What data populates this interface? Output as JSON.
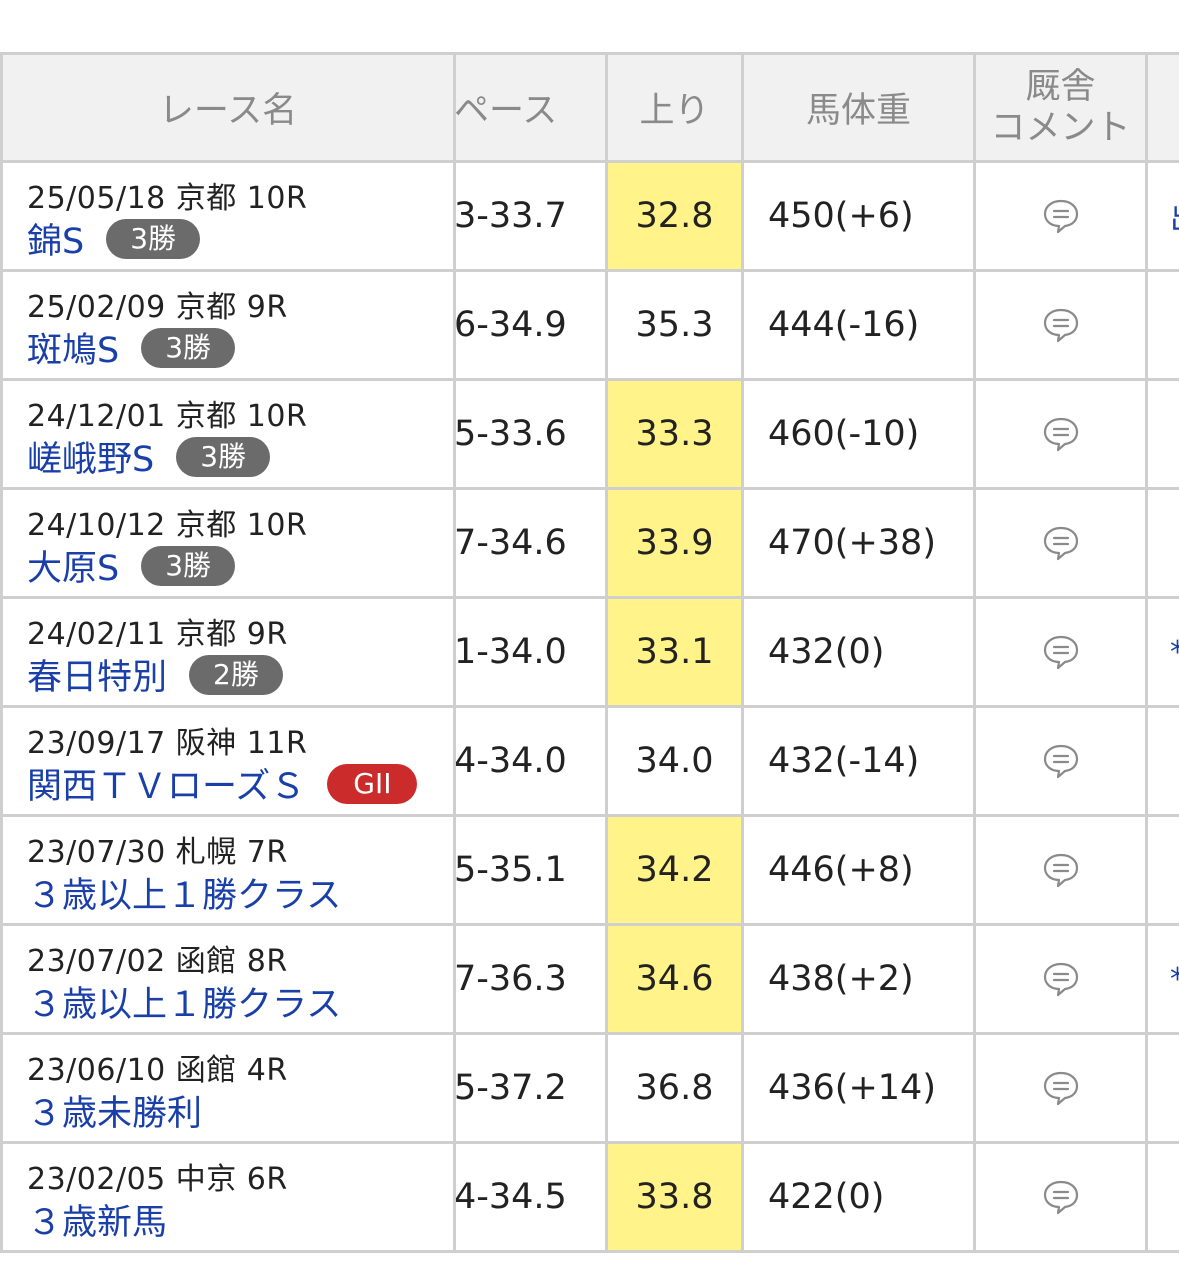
{
  "header": {
    "race_name": "レース名",
    "pace": "ペース",
    "agari": "上り",
    "weight": "馬体重",
    "comment": "厩舎\nコメント"
  },
  "rows": [
    {
      "date": "25/05/18 京都 10R",
      "race": "錦S",
      "badge": "3勝",
      "badge_type": "class",
      "pace": "3-33.7",
      "agari": "32.8",
      "agari_highlight": true,
      "weight": "450(+6)",
      "extra": "出"
    },
    {
      "date": "25/02/09 京都 9R",
      "race": "斑鳩S",
      "badge": "3勝",
      "badge_type": "class",
      "pace": "6-34.9",
      "agari": "35.3",
      "agari_highlight": false,
      "weight": "444(-16)",
      "extra": ""
    },
    {
      "date": "24/12/01 京都 10R",
      "race": "嵯峨野S",
      "badge": "3勝",
      "badge_type": "class",
      "pace": "5-33.6",
      "agari": "33.3",
      "agari_highlight": true,
      "weight": "460(-10)",
      "extra": ""
    },
    {
      "date": "24/10/12 京都 10R",
      "race": "大原S",
      "badge": "3勝",
      "badge_type": "class",
      "pace": "7-34.6",
      "agari": "33.9",
      "agari_highlight": true,
      "weight": "470(+38)",
      "extra": ""
    },
    {
      "date": "24/02/11 京都 9R",
      "race": "春日特別",
      "badge": "2勝",
      "badge_type": "class",
      "pace": "1-34.0",
      "agari": "33.1",
      "agari_highlight": true,
      "weight": "432(0)",
      "extra": "*"
    },
    {
      "date": "23/09/17 阪神 11R",
      "race": "関西ＴＶローズＳ",
      "badge": "GII",
      "badge_type": "grade",
      "pace": "4-34.0",
      "agari": "34.0",
      "agari_highlight": false,
      "weight": "432(-14)",
      "extra": ""
    },
    {
      "date": "23/07/30 札幌 7R",
      "race": "３歳以上１勝クラス",
      "badge": "",
      "badge_type": "",
      "pace": "5-35.1",
      "agari": "34.2",
      "agari_highlight": true,
      "weight": "446(+8)",
      "extra": ""
    },
    {
      "date": "23/07/02 函館 8R",
      "race": "３歳以上１勝クラス",
      "badge": "",
      "badge_type": "",
      "pace": "7-36.3",
      "agari": "34.6",
      "agari_highlight": true,
      "weight": "438(+2)",
      "extra": "*"
    },
    {
      "date": "23/06/10 函館 4R",
      "race": "３歳未勝利",
      "badge": "",
      "badge_type": "",
      "pace": "5-37.2",
      "agari": "36.8",
      "agari_highlight": false,
      "weight": "436(+14)",
      "extra": ""
    },
    {
      "date": "23/02/05 中京 6R",
      "race": "３歳新馬",
      "badge": "",
      "badge_type": "",
      "pace": "4-34.5",
      "agari": "33.8",
      "agari_highlight": true,
      "weight": "422(0)",
      "extra": ""
    }
  ],
  "icons": {
    "comment": "speech-bubble-icon"
  },
  "colors": {
    "highlight": "#fff38a",
    "race_link": "#1a3fa8",
    "class_badge": "#6b6b6b",
    "grade_badge": "#cc2b2b",
    "border": "#cfcfcf",
    "header_bg": "#f1f1f1"
  }
}
